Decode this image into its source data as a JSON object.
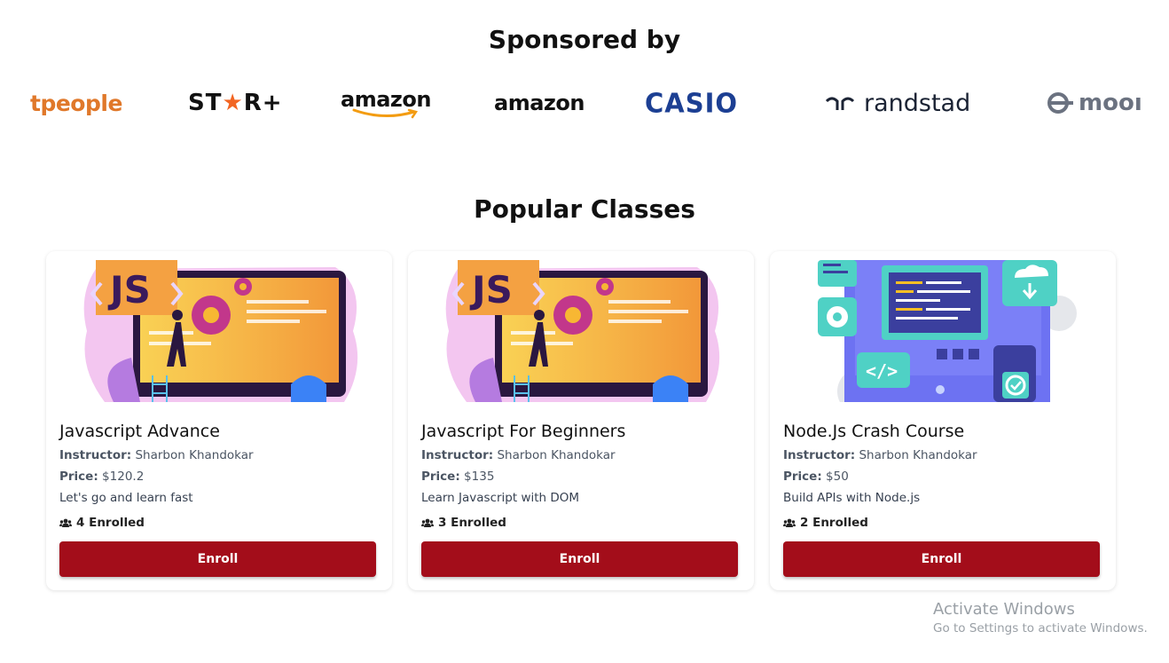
{
  "sponsor_section": {
    "title": "Sponsored by",
    "logos": [
      {
        "text_main": "tpeople",
        "icon": "people-logo"
      },
      {
        "text_a": "ST",
        "text_star": "★",
        "text_b": "R+",
        "icon": "star-plus-logo"
      },
      {
        "text": "amazon",
        "icon": "amazon-logo"
      },
      {
        "text": "amazon",
        "icon": "amazon-logo"
      },
      {
        "text": "CASIO",
        "icon": "casio-logo"
      },
      {
        "text": "randstad",
        "icon": "randstad-logo"
      },
      {
        "text": "mooı",
        "icon": "moo-logo"
      }
    ],
    "colors": {
      "people": "#e0782a",
      "star": "#f26522",
      "casio": "#1c3f93",
      "randstad": "#1b2334",
      "moo": "#6b7280"
    }
  },
  "classes_section": {
    "title": "Popular Classes",
    "instructor_label": "Instructor:",
    "price_label": "Price:",
    "cards": [
      {
        "title": "Javascript Advance",
        "instructor": "Sharbon Khandokar",
        "price": "$120.2",
        "description": "Let's go and learn fast",
        "enrolled": "4 Enrolled",
        "button": "Enroll",
        "image": "javascript-illustration"
      },
      {
        "title": "Javascript For Beginners",
        "instructor": "Sharbon Khandokar",
        "price": "$135",
        "description": "Learn Javascript with DOM",
        "enrolled": "3 Enrolled",
        "button": "Enroll",
        "image": "javascript-illustration"
      },
      {
        "title": "Node.Js Crash Course",
        "instructor": "Sharbon Khandokar",
        "price": "$50",
        "description": "Build APIs with Node.js",
        "enrolled": "2 Enrolled",
        "button": "Enroll",
        "image": "nodejs-illustration"
      }
    ],
    "colors": {
      "button": "#a30d1a"
    }
  },
  "os_watermark": {
    "title": "Activate Windows",
    "subtitle": "Go to Settings to activate Windows."
  }
}
